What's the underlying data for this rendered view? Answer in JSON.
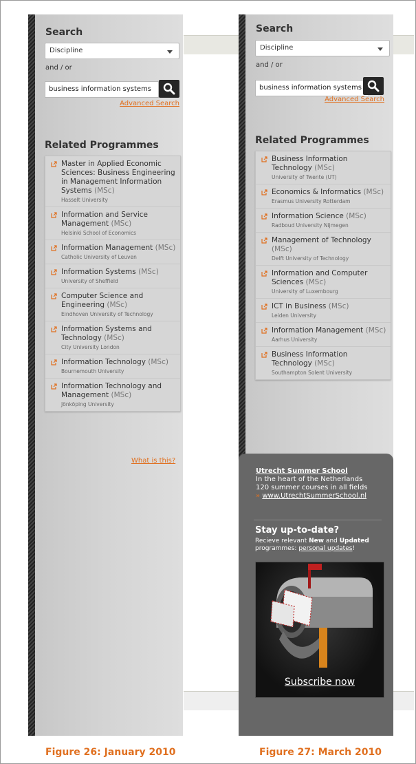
{
  "search": {
    "title": "Search",
    "discipline": "Discipline",
    "and_or": "and / or",
    "query": "business information systems",
    "advanced": "Advanced Search"
  },
  "related_title": "Related Programmes",
  "left_programmes": [
    {
      "title": "Master in Applied Economic Sciences: Business Engineering in Management Information Systems",
      "degree": "(MSc)",
      "university": "Hasselt University"
    },
    {
      "title": "Information and Service Management",
      "degree": "(MSc)",
      "university": "Helsinki School of Economics"
    },
    {
      "title": "Information Management",
      "degree": "(MSc)",
      "university": "Catholic University of Leuven"
    },
    {
      "title": "Information Systems",
      "degree": "(MSc)",
      "university": "University of Sheffield"
    },
    {
      "title": "Computer Science and Engineering",
      "degree": "(MSc)",
      "university": "Eindhoven University of Technology"
    },
    {
      "title": "Information Systems and Technology",
      "degree": "(MSc)",
      "university": "City University London"
    },
    {
      "title": "Information Technology",
      "degree": "(MSc)",
      "university": "Bournemouth University"
    },
    {
      "title": "Information Technology and Management",
      "degree": "(MSc)",
      "university": "Jönköping University"
    }
  ],
  "what_is_this": "What is this?",
  "right_programmes": [
    {
      "title": "Business Information Technology",
      "degree": "(MSc)",
      "university": "University of Twente (UT)"
    },
    {
      "title": "Economics & Informatics",
      "degree": "(MSc)",
      "university": "Erasmus University Rotterdam"
    },
    {
      "title": "Information Science",
      "degree": "(MSc)",
      "university": "Radboud University Nijmegen"
    },
    {
      "title": "Management of Technology",
      "degree": "(MSc)",
      "university": "Delft University of Technology"
    },
    {
      "title": "Information and Computer Sciences",
      "degree": "(MSc)",
      "university": "University of Luxembourg"
    },
    {
      "title": "ICT in Business",
      "degree": "(MSc)",
      "university": "Leiden University"
    },
    {
      "title": "Information Management",
      "degree": "(MSc)",
      "university": "Aarhus University"
    },
    {
      "title": "Business Information Technology",
      "degree": "(MSc)",
      "university": "Southampton Solent University"
    }
  ],
  "promo": {
    "title": "Utrecht Summer School",
    "line1": "In the heart of the Netherlands",
    "line2": "120 summer courses in all fields",
    "link": "www.UtrechtSummerSchool.nl",
    "bullet": "»"
  },
  "stay": {
    "title": "Stay up-to-date?",
    "text_pre": "Recieve relevant ",
    "text_new": "New",
    "text_and": " and ",
    "text_updated": "Updated",
    "text_mid": " programmes: ",
    "text_link": "personal updates",
    "text_end": "!",
    "subscribe": "Subscribe now"
  },
  "captions": {
    "left": "Figure 26: January 2010",
    "right": "Figure 27: March 2010"
  },
  "colors": {
    "accent": "#e07020",
    "promo_bg": "#676767"
  },
  "icons": {
    "search": "magnifier-icon",
    "external": "external-link-icon",
    "mailbox": "mailbox-icon"
  }
}
